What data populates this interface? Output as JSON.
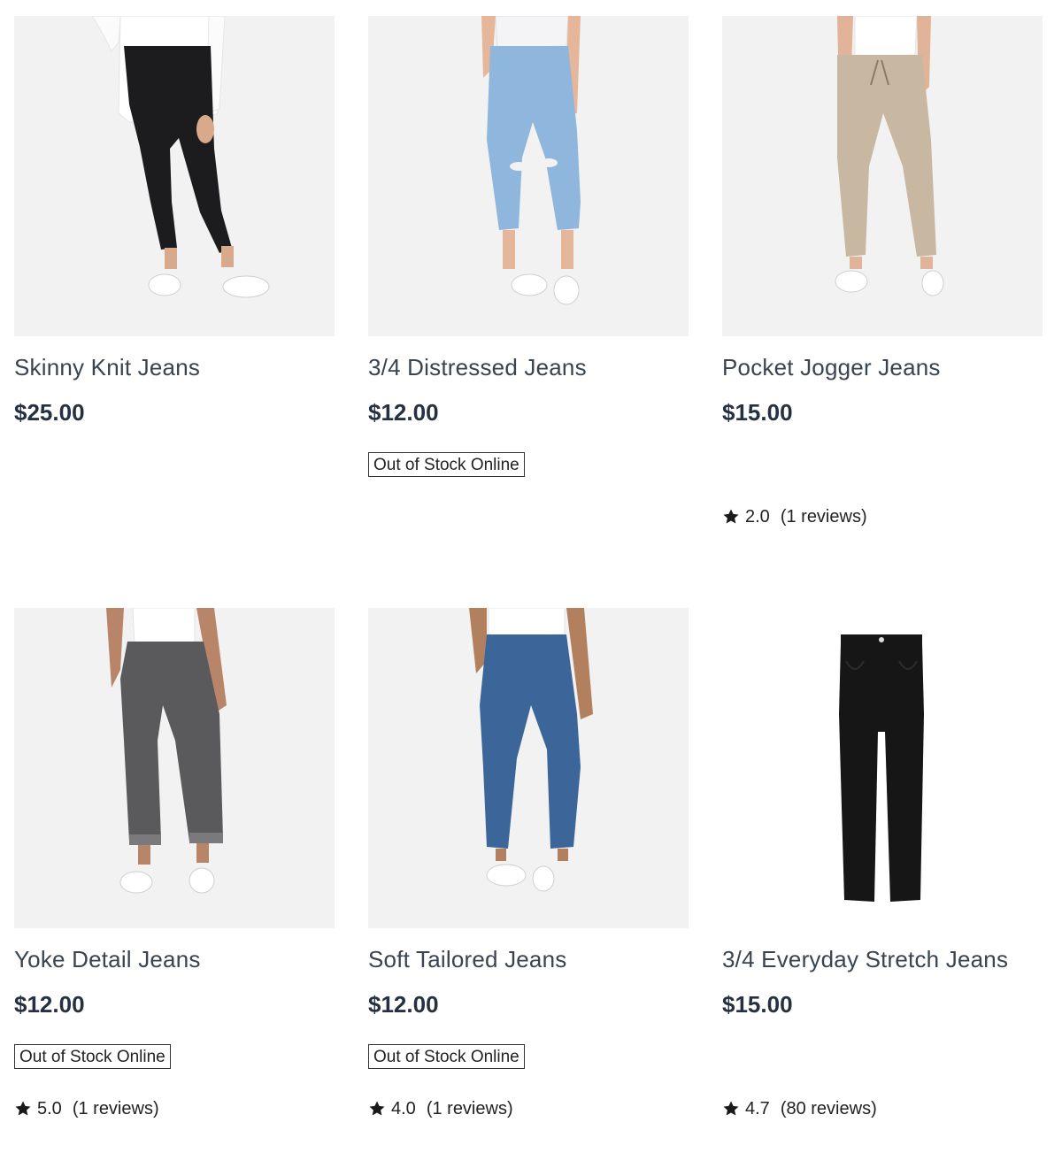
{
  "products": [
    {
      "title": "Skinny Knit Jeans",
      "price": "$25.00",
      "stock_badge": "",
      "rating": "",
      "reviews": "",
      "pants_color": "#1c1c1e",
      "top_color": "#ffffff"
    },
    {
      "title": "3/4 Distressed Jeans",
      "price": "$12.00",
      "stock_badge": "Out of Stock Online",
      "rating": "",
      "reviews": "",
      "pants_color": "#8fb6dc",
      "top_color": "#f4f4f6"
    },
    {
      "title": "Pocket Jogger Jeans",
      "price": "$15.00",
      "stock_badge": "",
      "rating": "2.0",
      "reviews": "(1 reviews)",
      "pants_color": "#c8b8a2",
      "top_color": "#ffffff"
    },
    {
      "title": "Yoke Detail Jeans",
      "price": "$12.00",
      "stock_badge": "Out of Stock Online",
      "rating": "5.0",
      "reviews": "(1 reviews)",
      "pants_color": "#5a5a5c",
      "top_color": "#ffffff"
    },
    {
      "title": "Soft Tailored Jeans",
      "price": "$12.00",
      "stock_badge": "Out of Stock Online",
      "rating": "4.0",
      "reviews": "(1 reviews)",
      "pants_color": "#3c6699",
      "top_color": "#ffffff"
    },
    {
      "title": "3/4 Everyday Stretch Jeans",
      "price": "$15.00",
      "stock_badge": "",
      "rating": "4.7",
      "reviews": "(80 reviews)",
      "pants_color": "#161616",
      "top_color": ""
    }
  ],
  "icons": {
    "rating": "star-icon",
    "product_image": "product-image"
  },
  "colors": {
    "text": "#3a4350",
    "price": "#253040",
    "image_background": "#f2f2f2",
    "badge_border": "#333333"
  }
}
